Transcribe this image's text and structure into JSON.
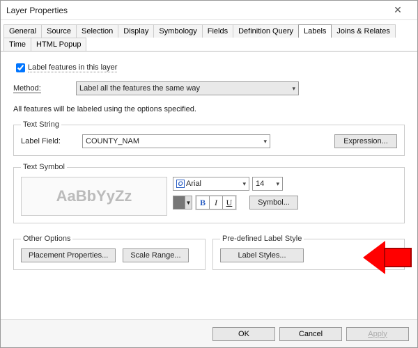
{
  "window": {
    "title": "Layer Properties"
  },
  "tabs": [
    "General",
    "Source",
    "Selection",
    "Display",
    "Symbology",
    "Fields",
    "Definition Query",
    "Labels",
    "Joins & Relates",
    "Time",
    "HTML Popup"
  ],
  "activeTab": "Labels",
  "labelsTab": {
    "checkbox": {
      "label": "Label features in this layer",
      "checked": true
    },
    "method": {
      "label": "Method:",
      "value": "Label all the features the same way"
    },
    "note": "All features will be labeled using the options specified.",
    "textString": {
      "legend": "Text String",
      "labelField": {
        "label": "Label Field:",
        "value": "COUNTY_NAM"
      },
      "expressionBtn": "Expression..."
    },
    "textSymbol": {
      "legend": "Text Symbol",
      "sample": "AaBbYyZz",
      "font": "Arial",
      "size": "14",
      "bold": "B",
      "italic": "I",
      "underline": "U",
      "symbolBtn": "Symbol...",
      "color": "#777777"
    },
    "otherOptions": {
      "legend": "Other Options",
      "placementBtn": "Placement Properties...",
      "scaleBtn": "Scale Range..."
    },
    "predefined": {
      "legend": "Pre-defined Label Style",
      "stylesBtn": "Label Styles..."
    }
  },
  "footer": {
    "ok": "OK",
    "cancel": "Cancel",
    "apply": "Apply"
  }
}
